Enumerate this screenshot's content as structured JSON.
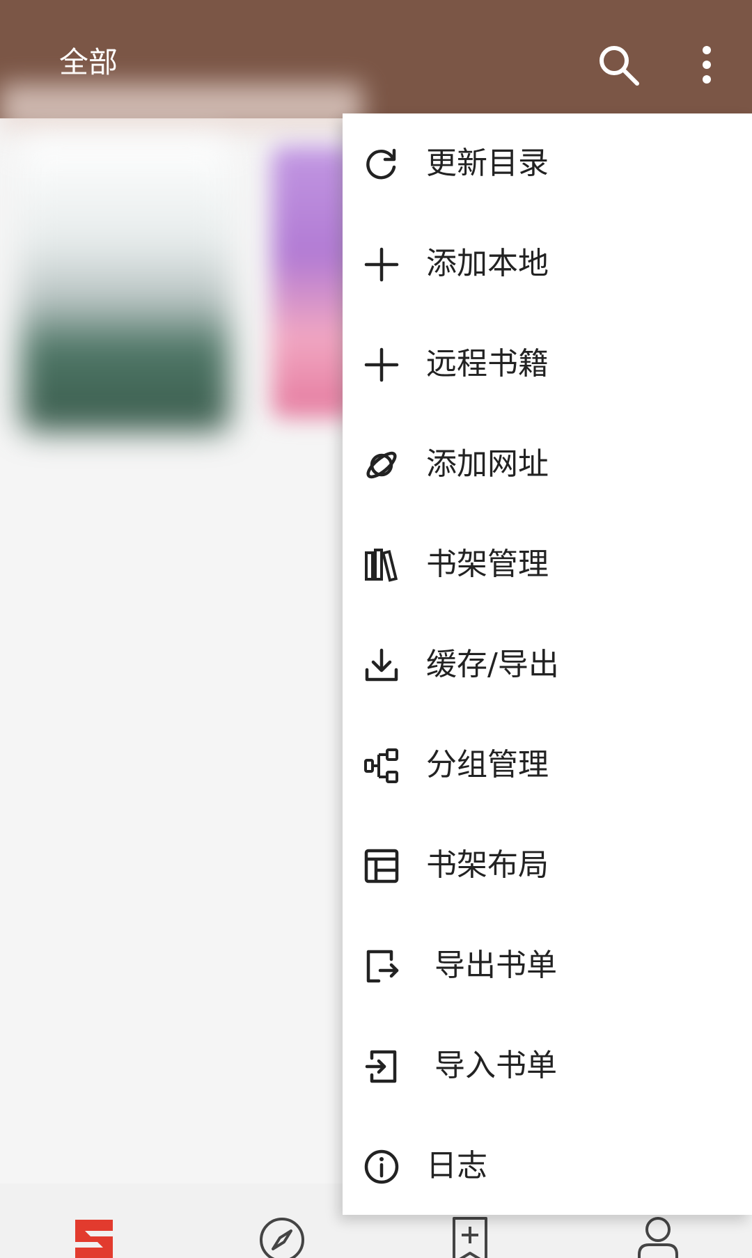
{
  "app_bar": {
    "title": "全部",
    "color": "#7b5646",
    "actions": [
      {
        "name": "search",
        "icon": "search-icon"
      },
      {
        "name": "more",
        "icon": "more-vert-icon"
      }
    ]
  },
  "menu": {
    "items": [
      {
        "label": "更新目录",
        "icon": "refresh-icon"
      },
      {
        "label": "添加本地",
        "icon": "plus-icon"
      },
      {
        "label": "远程书籍",
        "icon": "plus-icon"
      },
      {
        "label": "添加网址",
        "icon": "planet-icon"
      },
      {
        "label": "书架管理",
        "icon": "books-icon"
      },
      {
        "label": "缓存/导出",
        "icon": "download-icon"
      },
      {
        "label": "分组管理",
        "icon": "group-icon"
      },
      {
        "label": "书架布局",
        "icon": "layout-icon"
      },
      {
        "label": "导出书单",
        "icon": "export-icon"
      },
      {
        "label": "导入书单",
        "icon": "import-icon"
      },
      {
        "label": "日志",
        "icon": "info-icon"
      }
    ]
  },
  "bottom_nav": {
    "active_color": "#e23b2e",
    "tabs": [
      {
        "name": "bookshelf",
        "icon": "bookshelf-icon",
        "active": true
      },
      {
        "name": "explore",
        "icon": "compass-icon",
        "active": false
      },
      {
        "name": "rss",
        "icon": "bookmark-add-icon",
        "active": false
      },
      {
        "name": "my",
        "icon": "person-icon",
        "active": false
      }
    ]
  }
}
